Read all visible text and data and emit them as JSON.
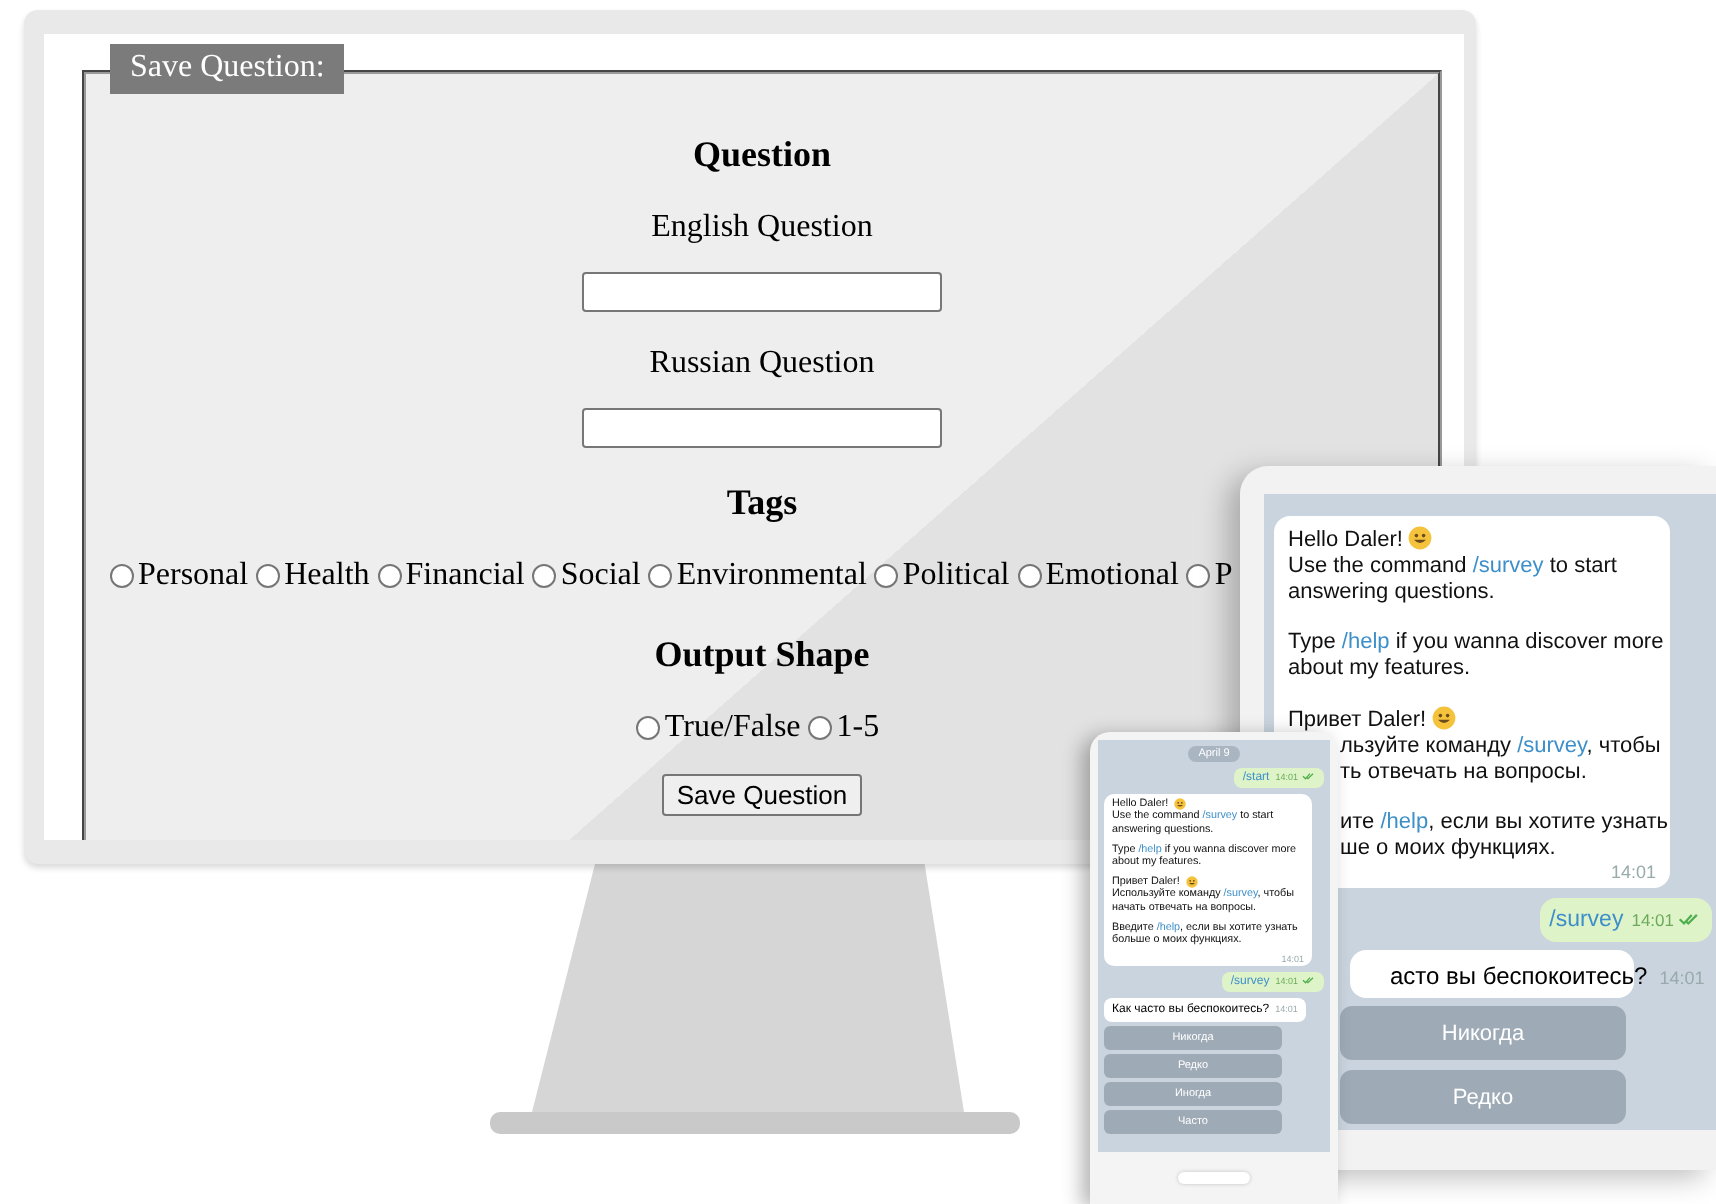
{
  "monitor": {
    "form": {
      "legend": "Save Question:",
      "heading": "Question",
      "fields": [
        {
          "label": "English Question"
        },
        {
          "label": "Russian Question"
        }
      ],
      "tags": {
        "heading": "Tags",
        "options": [
          {
            "label": "Personal",
            "selected": false
          },
          {
            "label": "Health",
            "selected": false
          },
          {
            "label": "Financial",
            "selected": false
          },
          {
            "label": "Social",
            "selected": false
          },
          {
            "label": "Environmental",
            "selected": false
          },
          {
            "label": "Political",
            "selected": false
          },
          {
            "label": "Emotional",
            "selected": false
          },
          {
            "label": "P",
            "selected": false
          }
        ]
      },
      "output_shape": {
        "heading": "Output Shape",
        "options": [
          {
            "label": "True/False",
            "selected": false
          },
          {
            "label": "1-5",
            "selected": false
          }
        ]
      },
      "submit": "Save Question"
    }
  },
  "tablet": {
    "chat": {
      "incoming": {
        "blocks": [
          {
            "greeting": "Hello Daler!",
            "lines": [
              {
                "kind": "full",
                "segments": [
                  {
                    "kind": "plain",
                    "text": "Use the command "
                  },
                  {
                    "kind": "command",
                    "text": "/survey"
                  },
                  {
                    "kind": "plain",
                    "text": " to start"
                  }
                ]
              },
              {
                "kind": "full",
                "segments": [
                  {
                    "kind": "plain",
                    "text": "answering questions."
                  }
                ]
              }
            ]
          },
          {
            "lines": [
              {
                "kind": "full",
                "segments": [
                  {
                    "kind": "plain",
                    "text": "Type "
                  },
                  {
                    "kind": "command",
                    "text": "/help"
                  },
                  {
                    "kind": "plain",
                    "text": " if you wanna discover more"
                  }
                ]
              },
              {
                "kind": "full",
                "segments": [
                  {
                    "kind": "plain",
                    "text": "about my features."
                  }
                ]
              }
            ]
          },
          {
            "greeting": "Привет Daler!",
            "lines": [
              {
                "kind": "cut",
                "segments": [
                  {
                    "kind": "plain",
                    "text": "льзуйте команду "
                  },
                  {
                    "kind": "command",
                    "text": "/survey"
                  },
                  {
                    "kind": "plain",
                    "text": ", чтобы"
                  }
                ]
              },
              {
                "kind": "cut",
                "segments": [
                  {
                    "kind": "plain",
                    "text": "ть отвечать на вопросы."
                  }
                ]
              }
            ]
          },
          {
            "lines": [
              {
                "kind": "cut",
                "segments": [
                  {
                    "kind": "plain",
                    "text": "ите "
                  },
                  {
                    "kind": "command",
                    "text": "/help"
                  },
                  {
                    "kind": "plain",
                    "text": ", если вы хотите узнать"
                  }
                ]
              },
              {
                "kind": "cut",
                "segments": [
                  {
                    "kind": "plain",
                    "text": "ше о моих функциях."
                  }
                ]
              }
            ]
          }
        ],
        "time": "14:01"
      },
      "outgoing": {
        "text": "/survey",
        "time": "14:01"
      },
      "question": {
        "text": "асто вы беспокоитесь?",
        "time": "14:01"
      },
      "answers": [
        "Никогда",
        "Редко"
      ]
    }
  },
  "phone": {
    "chat": {
      "date": "April 9",
      "start": {
        "text": "/start",
        "time": "14:01"
      },
      "incoming": {
        "blocks": [
          {
            "greeting": "Hello Daler!",
            "segments": [
              {
                "kind": "plain",
                "text": "Use the command "
              },
              {
                "kind": "command",
                "text": "/survey"
              },
              {
                "kind": "plain",
                "text": " to start answering questions."
              }
            ]
          },
          {
            "segments": [
              {
                "kind": "plain",
                "text": "Type "
              },
              {
                "kind": "command",
                "text": "/help"
              },
              {
                "kind": "plain",
                "text": " if you wanna discover more about my features."
              }
            ]
          },
          {
            "greeting": "Привет Daler!",
            "segments": [
              {
                "kind": "plain",
                "text": "Используйте команду "
              },
              {
                "kind": "command",
                "text": "/survey"
              },
              {
                "kind": "plain",
                "text": ", чтобы начать отвечать на вопросы."
              }
            ]
          },
          {
            "segments": [
              {
                "kind": "plain",
                "text": "Введите "
              },
              {
                "kind": "command",
                "text": "/help"
              },
              {
                "kind": "plain",
                "text": ", если вы хотите узнать больше о моих функциях."
              }
            ]
          }
        ],
        "time": "14:01"
      },
      "outgoing": {
        "text": "/survey",
        "time": "14:01"
      },
      "question": {
        "text": "Как часто вы беспокоитесь?",
        "time": "14:01"
      },
      "answers": [
        "Никогда",
        "Редко",
        "Иногда",
        "Часто"
      ]
    }
  }
}
